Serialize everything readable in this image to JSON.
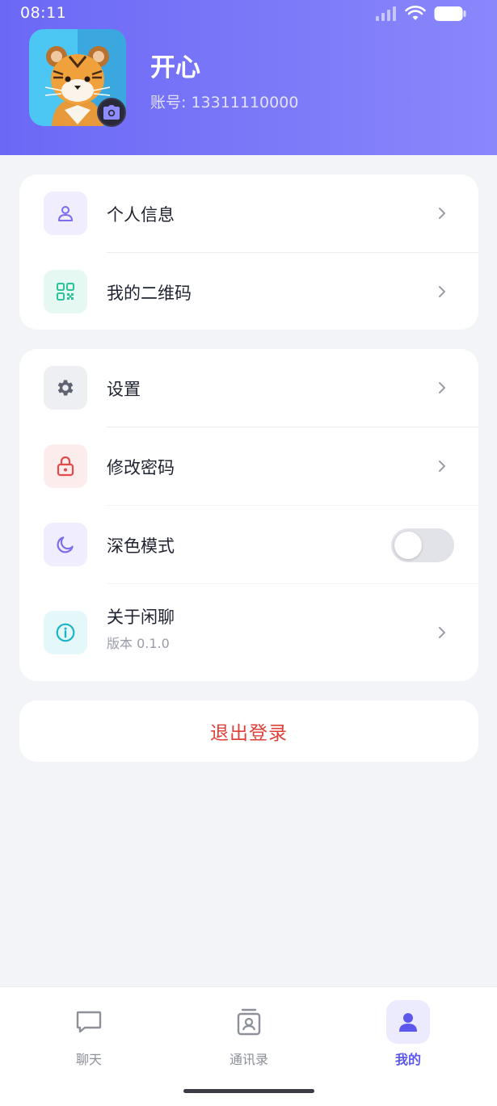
{
  "status_bar": {
    "time": "08:11"
  },
  "profile": {
    "name": "开心",
    "account": "账号: 13311110000"
  },
  "menu_group_1": [
    {
      "label": "个人信息",
      "icon": "person-icon",
      "icon_color": "#7b6cf0",
      "icon_bg": "#efedfe"
    },
    {
      "label": "我的二维码",
      "icon": "qrcode-icon",
      "icon_color": "#2cc39a",
      "icon_bg": "#e6f8f2"
    }
  ],
  "menu_group_2": [
    {
      "label": "设置",
      "icon": "gear-icon",
      "icon_color": "#5f6270",
      "icon_bg": "#eeeff2"
    },
    {
      "label": "修改密码",
      "icon": "lock-icon",
      "icon_color": "#e34a4a",
      "icon_bg": "#fdecec"
    },
    {
      "label": "深色模式",
      "icon": "moon-icon",
      "icon_color": "#7b6cf0",
      "icon_bg": "#efedfe",
      "toggle_on": false
    },
    {
      "label": "关于闲聊",
      "sublabel": "版本 0.1.0",
      "icon": "info-icon",
      "icon_color": "#17b3c8",
      "icon_bg": "#e4f7f9"
    }
  ],
  "logout_label": "退出登录",
  "bottom_nav": [
    {
      "label": "聊天",
      "icon": "chat-icon",
      "active": false
    },
    {
      "label": "通讯录",
      "icon": "contacts-icon",
      "active": false
    },
    {
      "label": "我的",
      "icon": "profile-icon",
      "active": true
    }
  ],
  "colors": {
    "header_start": "#6b68f6",
    "header_end": "#8a87fb",
    "accent": "#5c58ec",
    "danger": "#e0403a"
  }
}
